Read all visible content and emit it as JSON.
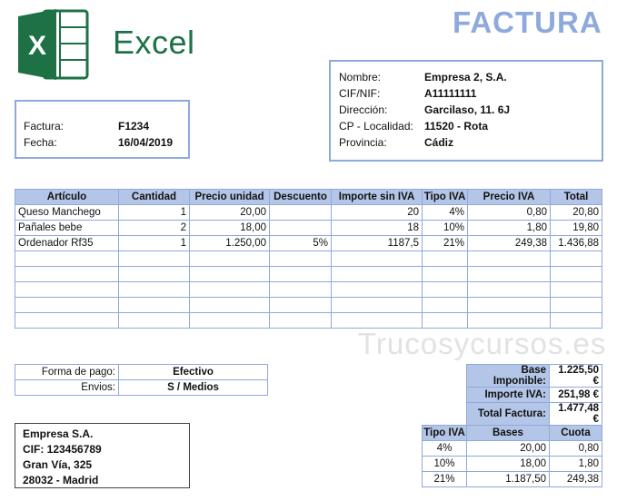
{
  "logo": {
    "word": "Excel",
    "letter": "X"
  },
  "title": "FACTURA",
  "invoice": {
    "number_label": "Factura:",
    "number": "F1234",
    "date_label": "Fecha:",
    "date": "16/04/2019"
  },
  "client": {
    "rows": [
      {
        "label": "Nombre:",
        "value": "Empresa 2, S.A."
      },
      {
        "label": "CIF/NIF:",
        "value": "A11111111"
      },
      {
        "label": "Dirección:",
        "value": "Garcilaso, 11. 6J"
      },
      {
        "label": "CP - Localidad:",
        "value": "11520 - Rota"
      },
      {
        "label": "Provincia:",
        "value": "Cádiz"
      }
    ]
  },
  "items": {
    "headers": [
      "Artículo",
      "Cantidad",
      "Precio unidad",
      "Descuento",
      "Importe sin IVA",
      "Tipo IVA",
      "Precio IVA",
      "Total"
    ],
    "rows": [
      [
        "Queso Manchego",
        "1",
        "20,00",
        "",
        "20",
        "4%",
        "0,80",
        "20,80"
      ],
      [
        "Pañales bebe",
        "2",
        "18,00",
        "",
        "18",
        "10%",
        "1,80",
        "19,80"
      ],
      [
        "Ordenador Rf35",
        "1",
        "1.250,00",
        "5%",
        "1187,5",
        "21%",
        "249,38",
        "1.436,88"
      ],
      [
        "",
        "",
        "",
        "",
        "",
        "",
        "",
        ""
      ],
      [
        "",
        "",
        "",
        "",
        "",
        "",
        "",
        ""
      ],
      [
        "",
        "",
        "",
        "",
        "",
        "",
        "",
        ""
      ],
      [
        "",
        "",
        "",
        "",
        "",
        "",
        "",
        ""
      ],
      [
        "",
        "",
        "",
        "",
        "",
        "",
        "",
        ""
      ]
    ]
  },
  "watermark": "Trucosycursos.es",
  "payment": {
    "method_label": "Forma de pago:",
    "method": "Efectivo",
    "shipping_label": "Envios:",
    "shipping": "S / Medios"
  },
  "totals": {
    "base_label": "Base Imponible:",
    "base": "1.225,50 €",
    "iva_label": "Importe IVA:",
    "iva": "251,98 €",
    "total_label": "Total Factura:",
    "total": "1.477,48 €"
  },
  "company": {
    "lines": [
      "Empresa S.A.",
      "CIF: 123456789",
      "Gran Vía, 325",
      "28032 - Madrid"
    ]
  },
  "tax": {
    "headers": [
      "Tipo IVA",
      "Bases",
      "Cuota"
    ],
    "rows": [
      [
        "4%",
        "20,00",
        "0,80"
      ],
      [
        "10%",
        "18,00",
        "1,80"
      ],
      [
        "21%",
        "1.187,50",
        "249,38"
      ]
    ]
  },
  "colors": {
    "accent": "#8ea9db",
    "header_fill": "#b4c6e7",
    "excel_green": "#1e7145"
  }
}
